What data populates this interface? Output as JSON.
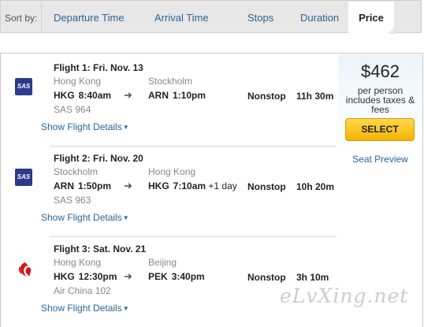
{
  "sort": {
    "label": "Sort by:",
    "options": [
      "Departure Time",
      "Arrival Time",
      "Stops",
      "Duration",
      "Price"
    ]
  },
  "price": {
    "amount": "$462",
    "note_line1": "per person",
    "note_line2": "includes taxes &",
    "note_line3": "fees",
    "select_label": "SELECT",
    "seat_preview": "Seat Preview"
  },
  "flights": [
    {
      "title": "Flight 1:  Fri. Nov. 13",
      "from_city": "Hong Kong",
      "to_city": "Stockholm",
      "from_code": "HKG",
      "depart_time": "8:40am",
      "to_code": "ARN",
      "arrive_time": "1:10pm",
      "plus_day": "",
      "stops": "Nonstop",
      "duration": "11h 30m",
      "flight_no": "SAS 964",
      "airline_logo": "SAS",
      "details_link": "Show Flight Details"
    },
    {
      "title": "Flight 2:  Fri. Nov. 20",
      "from_city": "Stockholm",
      "to_city": "Hong Kong",
      "from_code": "ARN",
      "depart_time": "1:50pm",
      "to_code": "HKG",
      "arrive_time": "7:10am",
      "plus_day": "+1 day",
      "stops": "Nonstop",
      "duration": "10h 20m",
      "flight_no": "SAS 963",
      "airline_logo": "SAS",
      "details_link": "Show Flight Details"
    },
    {
      "title": "Flight 3:  Sat. Nov. 21",
      "from_city": "Hong Kong",
      "to_city": "Beijing",
      "from_code": "HKG",
      "depart_time": "12:30pm",
      "to_code": "PEK",
      "arrive_time": "3:40pm",
      "plus_day": "",
      "stops": "Nonstop",
      "duration": "3h 10m",
      "flight_no": "Air China 102",
      "airline_logo": "air-china-phoenix-logo",
      "details_link": "Show Flight Details"
    }
  ],
  "watermark": "eLvXing.net",
  "colors": {
    "link": "#2a6496",
    "select_button": "#f4b400",
    "sas_blue": "#2b3a8c",
    "air_china_red": "#d7141a"
  }
}
